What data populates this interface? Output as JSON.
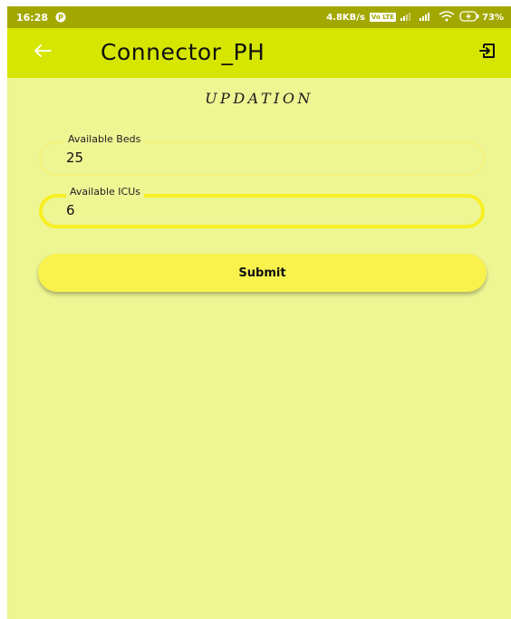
{
  "status_bar": {
    "time": "16:28",
    "app_glyph": "P",
    "network_speed": "4.8KB/s",
    "volte": "Vo LTE",
    "battery": "73%"
  },
  "app_bar": {
    "title": "Connector_PH",
    "back_icon": "arrow-left-icon",
    "logout_icon": "exit-icon"
  },
  "page": {
    "heading": "UPDATION"
  },
  "form": {
    "beds": {
      "label": "Available Beds",
      "value": "25"
    },
    "icus": {
      "label": "Available ICUs",
      "value": "6"
    },
    "submit_label": "Submit"
  },
  "colors": {
    "status_bar": "#a3a800",
    "app_bar": "#d6e600",
    "background": "#eef593",
    "button": "#f9f24d",
    "focused_border": "#f7ef22"
  }
}
